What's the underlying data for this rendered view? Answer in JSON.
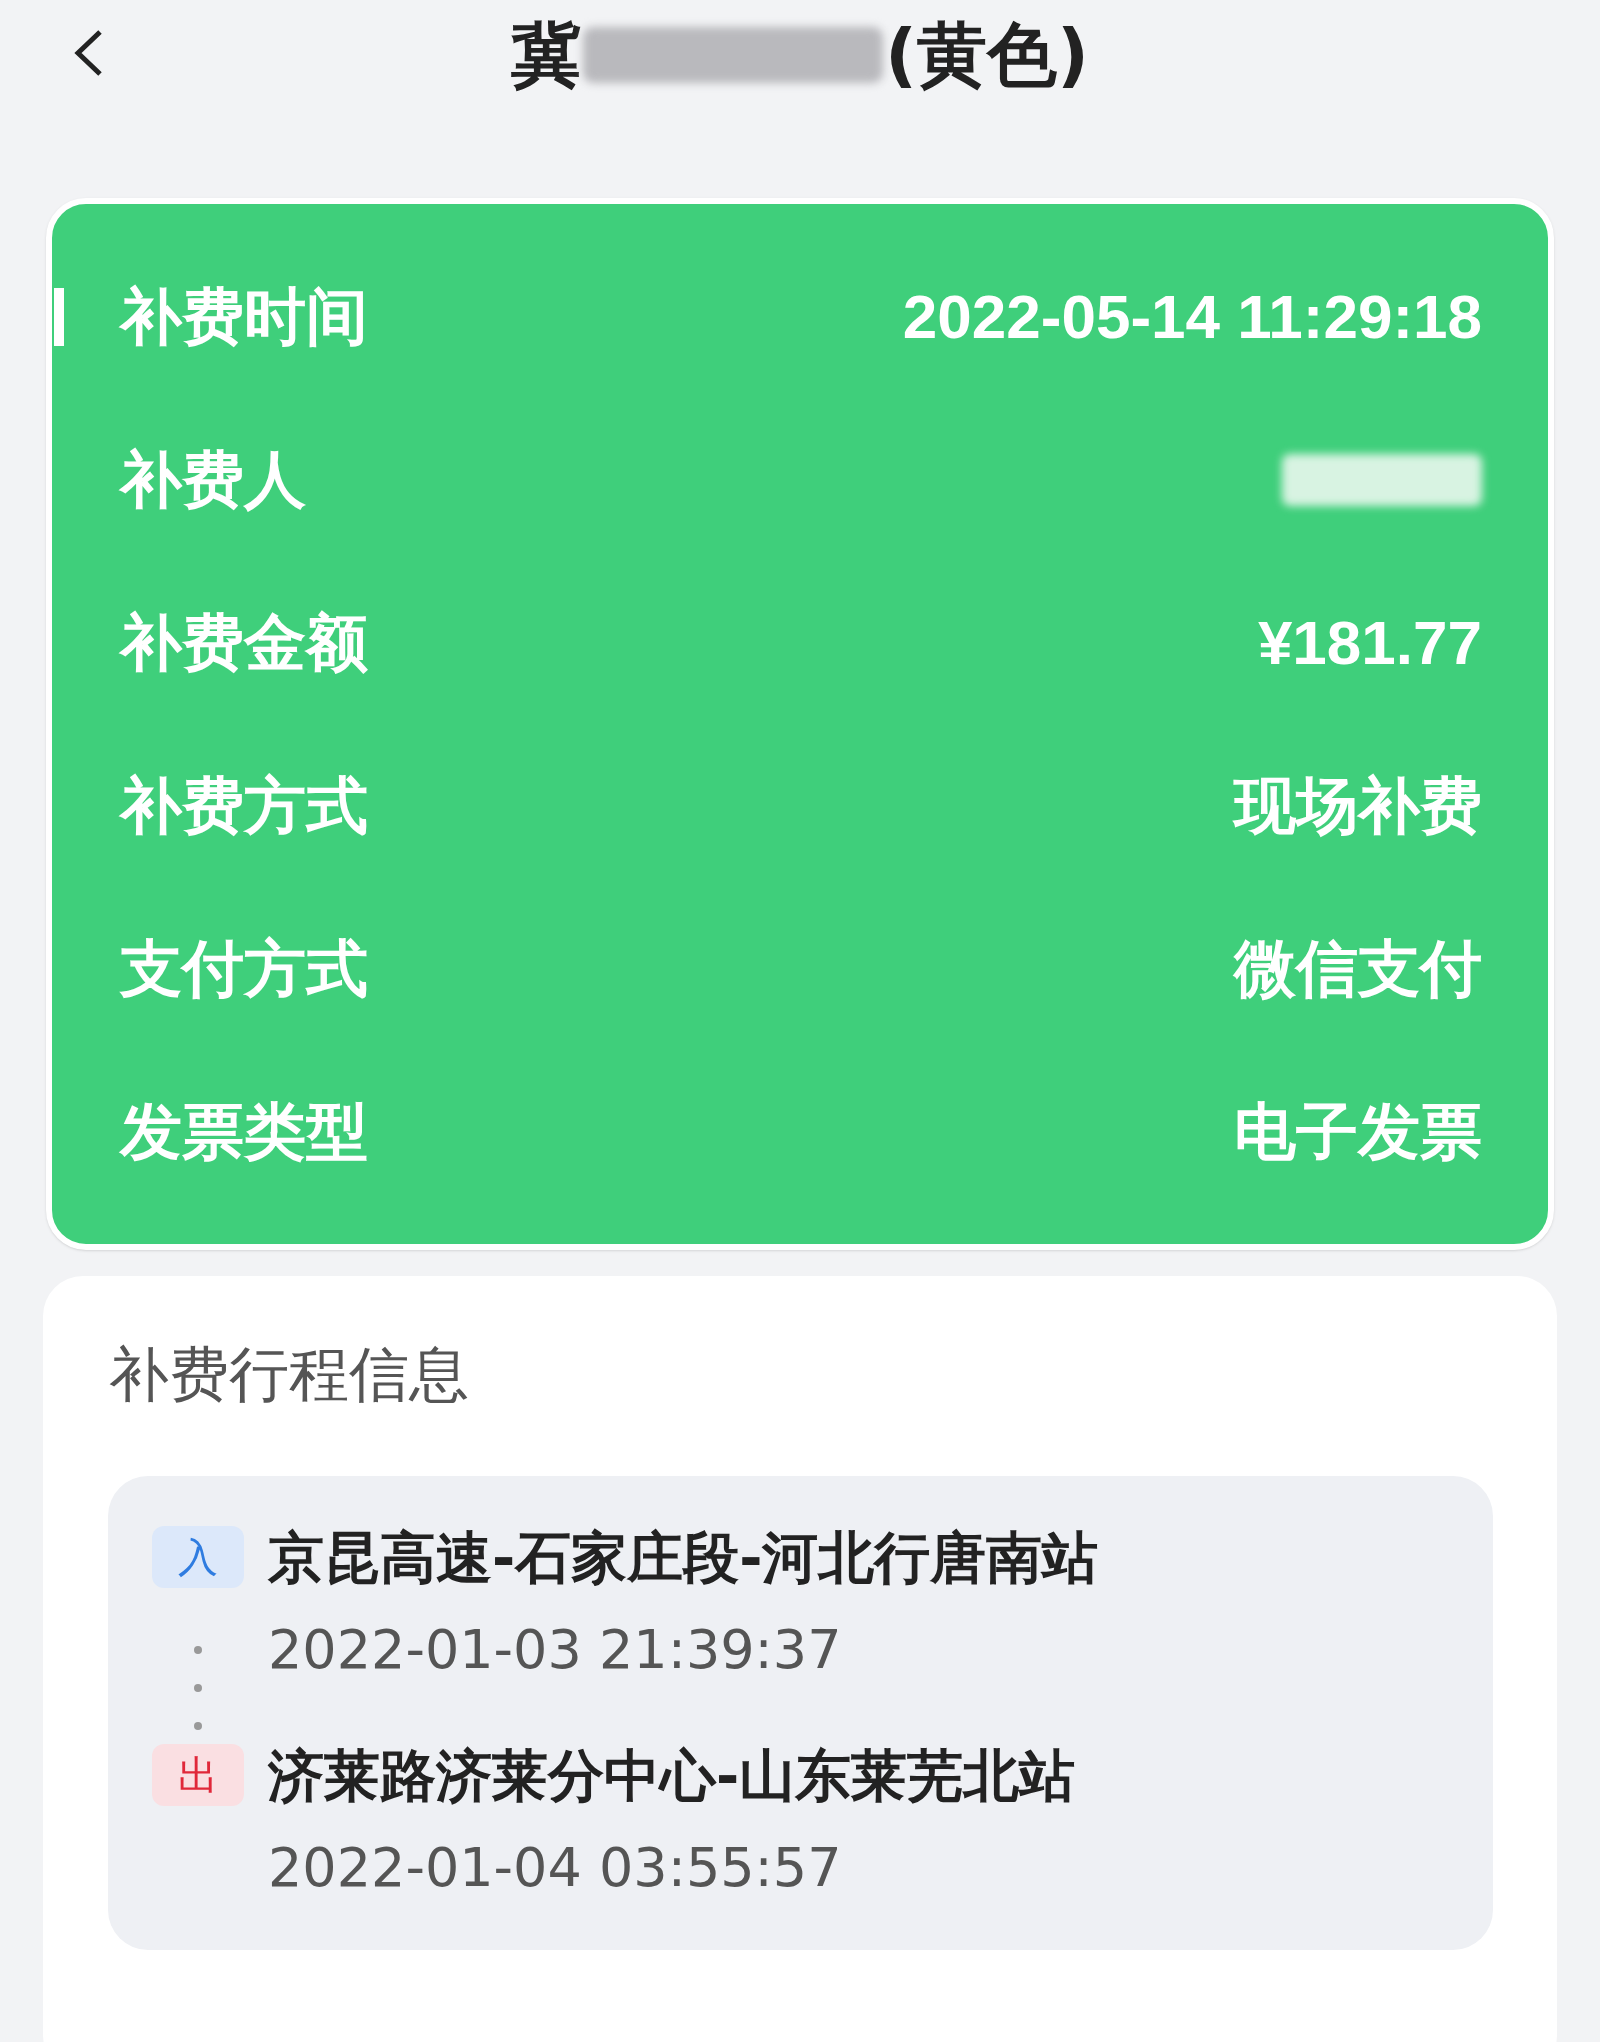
{
  "header": {
    "title_start": "冀",
    "title_end": "(黄色)"
  },
  "summary": {
    "rows": [
      {
        "label": "补费时间",
        "value": "2022-05-14 11:29:18",
        "kind": "text",
        "selected": true
      },
      {
        "label": "补费人",
        "kind": "redacted",
        "selected": false
      },
      {
        "label": "补费金额",
        "value": "¥181.77",
        "kind": "text",
        "selected": false
      },
      {
        "label": "补费方式",
        "value": "现场补费",
        "kind": "text",
        "selected": false
      },
      {
        "label": "支付方式",
        "value": "微信支付",
        "kind": "text",
        "selected": false
      },
      {
        "label": "发票类型",
        "value": "电子发票",
        "kind": "text",
        "selected": false
      }
    ]
  },
  "trip": {
    "title": "补费行程信息",
    "stops": [
      {
        "kind": "entry",
        "badge": "入",
        "station": "京昆高速-石家庄段-河北行唐南站",
        "time": "2022-01-03 21:39:37"
      },
      {
        "kind": "exit",
        "badge": "出",
        "station": "济莱路济莱分中心-山东莱芜北站",
        "time": "2022-01-04 03:55:57"
      }
    ]
  }
}
